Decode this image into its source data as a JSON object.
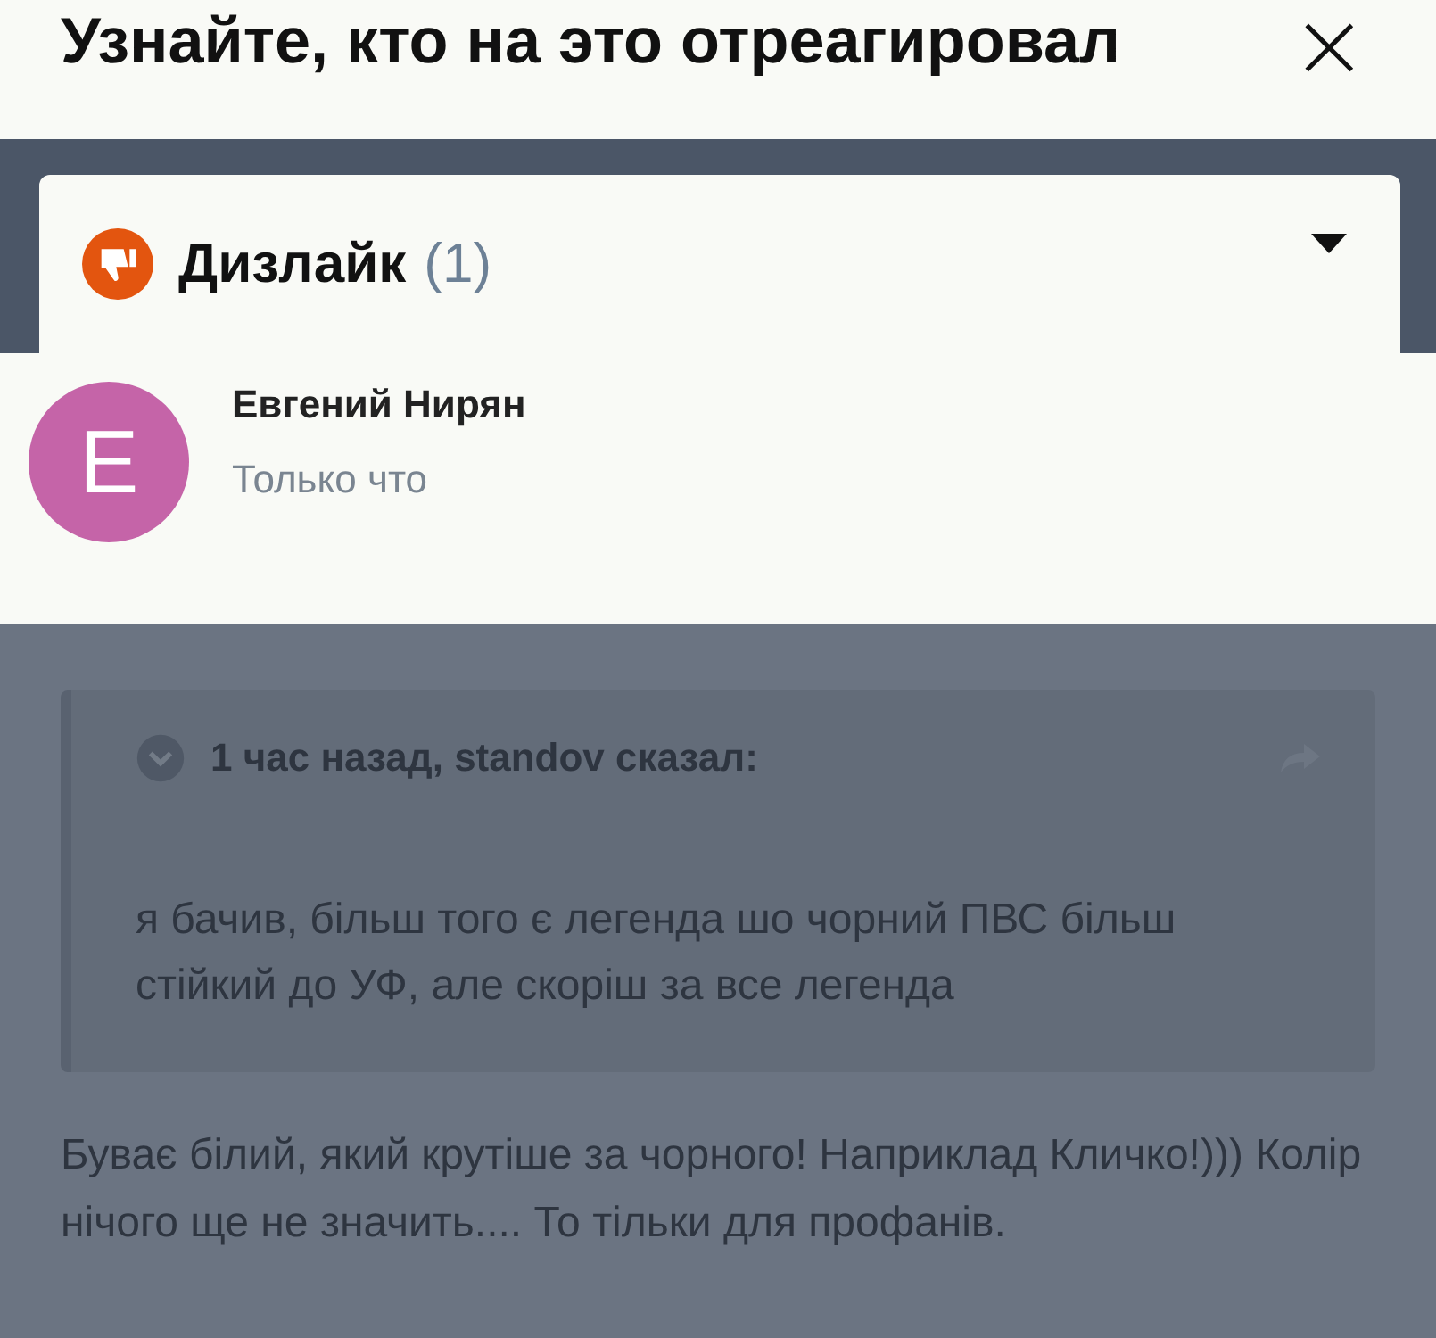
{
  "title": "Узнайте, кто на это отреагировал",
  "close": "×",
  "reaction": {
    "label": "Дизлайк",
    "count": "(1)",
    "expanded": true
  },
  "reactors": [
    {
      "initial": "E",
      "name": "Евгений Нирян",
      "time": "Только что",
      "color": "#c564a8"
    }
  ],
  "background": {
    "quote": {
      "header": "1 час назад, standov сказал:",
      "text": "я бачив, більш того є легенда шо чорний ПВС більш стійкий до УФ, але скоріш за все легенда"
    },
    "post": "Буває білий, який крутіше за чорного! Наприклад Кличко!))) Колір нічого ще не значить.... То тільки для профанів."
  }
}
